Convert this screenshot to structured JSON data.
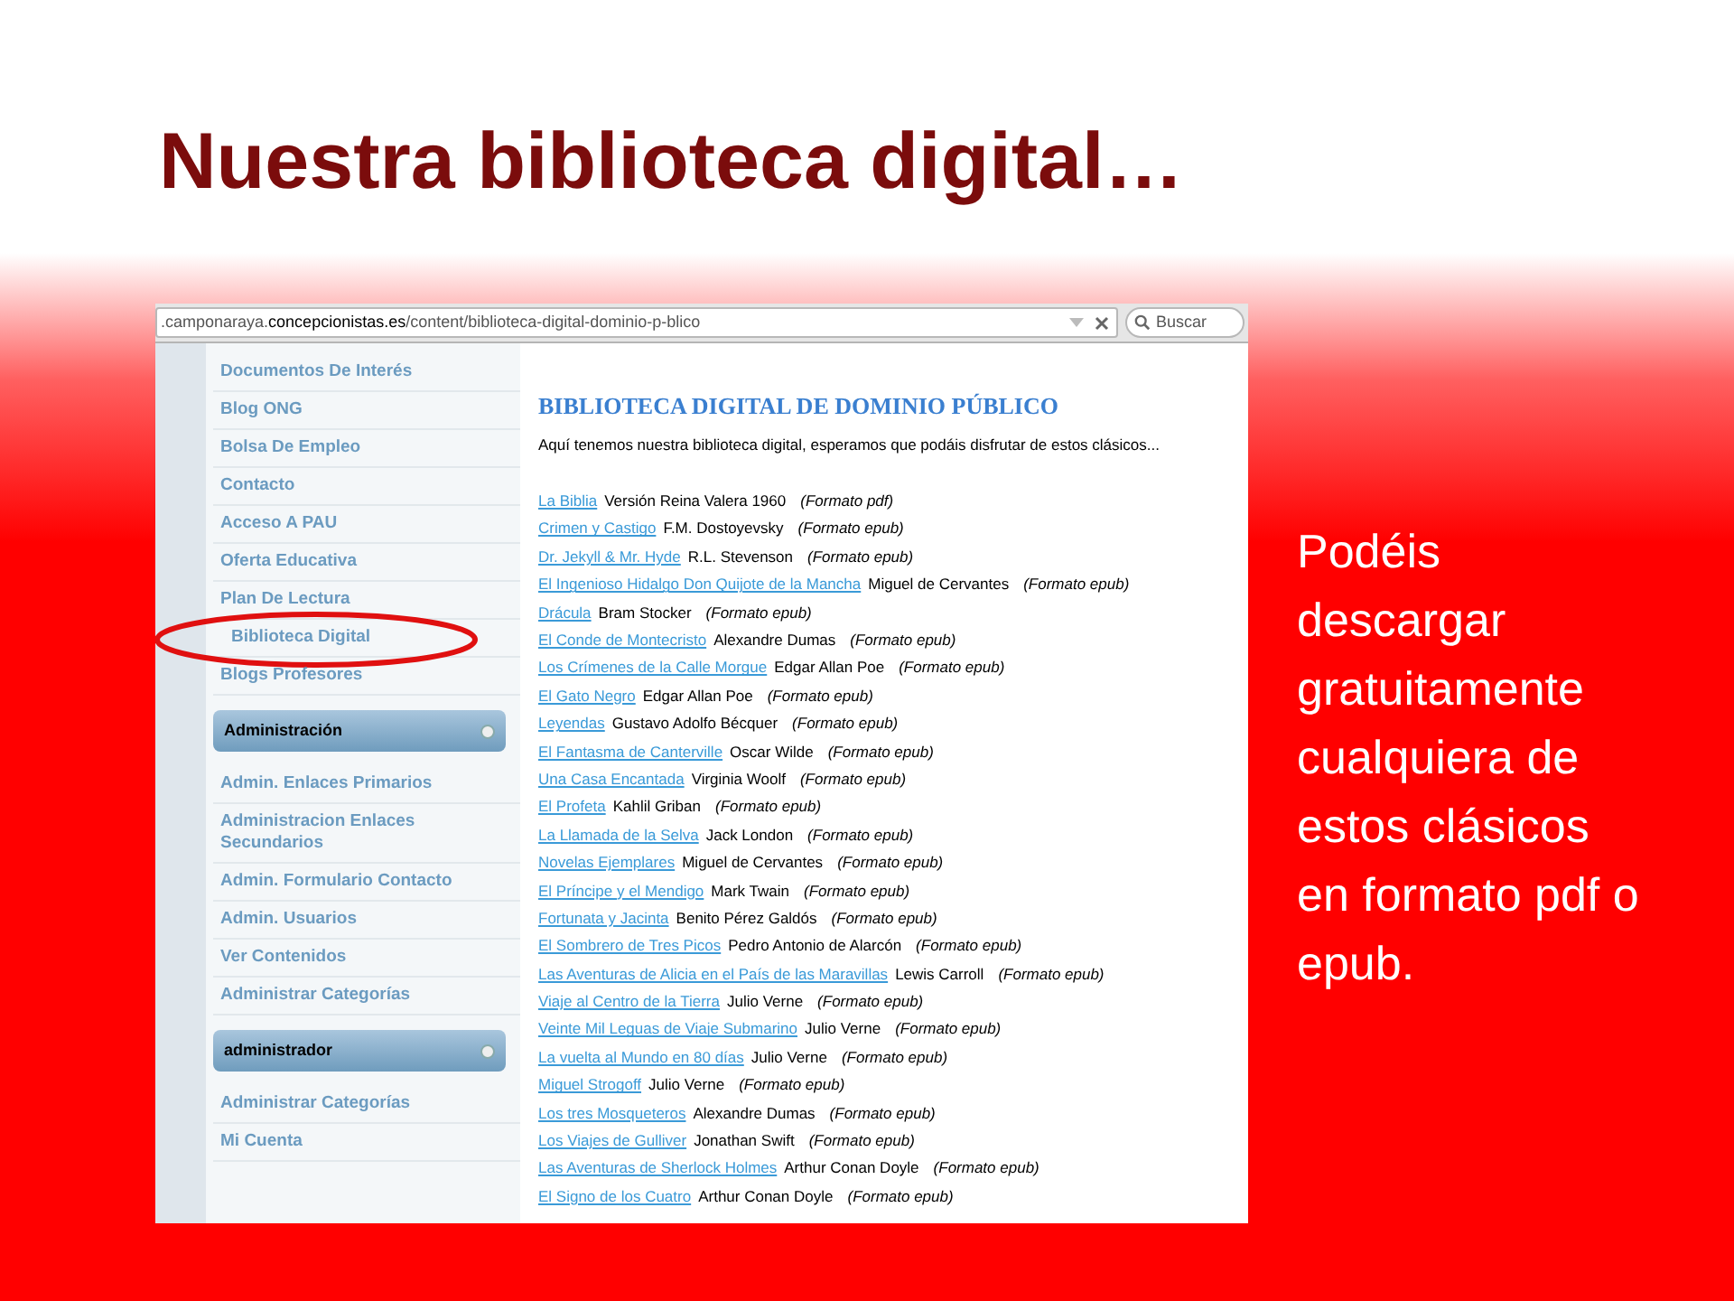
{
  "slide_title": "Nuestra biblioteca digital…",
  "browser": {
    "url_prefix": ".camponaraya.",
    "url_domain": "concepcionistas.es",
    "url_path": "/content/biblioteca-digital-dominio-p-blico",
    "search_placeholder": "Buscar"
  },
  "sidebar": {
    "items": [
      {
        "kind": "link",
        "label": "Documentos De Interés",
        "circled": false
      },
      {
        "kind": "link",
        "label": "Blog ONG",
        "circled": false
      },
      {
        "kind": "link",
        "label": "Bolsa De Empleo",
        "circled": false
      },
      {
        "kind": "link",
        "label": "Contacto",
        "circled": false
      },
      {
        "kind": "link",
        "label": "Acceso A PAU",
        "circled": false
      },
      {
        "kind": "link",
        "label": "Oferta Educativa",
        "circled": false
      },
      {
        "kind": "link",
        "label": "Plan De Lectura",
        "circled": false
      },
      {
        "kind": "link",
        "label": "Biblioteca Digital",
        "circled": true
      },
      {
        "kind": "link",
        "label": "Blogs Profesores",
        "circled": false
      },
      {
        "kind": "header",
        "label": "Administración"
      },
      {
        "kind": "link",
        "label": "Admin. Enlaces Primarios",
        "circled": false
      },
      {
        "kind": "link",
        "label": "Administracion Enlaces Secundarios",
        "circled": false
      },
      {
        "kind": "link",
        "label": "Admin. Formulario Contacto",
        "circled": false
      },
      {
        "kind": "link",
        "label": "Admin. Usuarios",
        "circled": false
      },
      {
        "kind": "link",
        "label": "Ver Contenidos",
        "circled": false
      },
      {
        "kind": "link",
        "label": "Administrar Categorías",
        "circled": false
      },
      {
        "kind": "header",
        "label": "administrador"
      },
      {
        "kind": "link",
        "label": "Administrar Categorías",
        "circled": false
      },
      {
        "kind": "link",
        "label": "Mi Cuenta",
        "circled": false
      }
    ]
  },
  "content": {
    "heading": "BIBLIOTECA DIGITAL DE DOMINIO PÚBLICO",
    "intro": "Aquí tenemos nuestra biblioteca digital, esperamos que podáis disfrutar de estos clásicos...",
    "books": [
      {
        "title": "La Biblia",
        "author": "Versión Reina Valera 1960",
        "format": "(Formato pdf)"
      },
      {
        "title": "Crimen y Castigo",
        "author": "F.M. Dostoyevsky",
        "format": "(Formato epub)"
      },
      {
        "title": "Dr. Jekyll & Mr. Hyde",
        "author": "R.L. Stevenson",
        "format": "(Formato epub)"
      },
      {
        "title": "El Ingenioso Hidalgo Don Quijote de la Mancha",
        "author": "Miguel de Cervantes",
        "format": "(Formato epub)"
      },
      {
        "title": "Drácula",
        "author": "Bram Stocker",
        "format": "(Formato epub)"
      },
      {
        "title": "El Conde de Montecristo",
        "author": "Alexandre Dumas",
        "format": "(Formato epub)"
      },
      {
        "title": "Los Crímenes de la Calle Morgue",
        "author": "Edgar Allan Poe",
        "format": "(Formato epub)"
      },
      {
        "title": "El Gato Negro",
        "author": "Edgar Allan Poe",
        "format": "(Formato epub)"
      },
      {
        "title": "Leyendas",
        "author": "Gustavo Adolfo Bécquer",
        "format": "(Formato epub)"
      },
      {
        "title": "El Fantasma de Canterville",
        "author": "Oscar Wilde",
        "format": "(Formato epub)"
      },
      {
        "title": "Una Casa Encantada",
        "author": "Virginia Woolf",
        "format": "(Formato epub)"
      },
      {
        "title": "El Profeta",
        "author": "Kahlil Griban",
        "format": "(Formato epub)"
      },
      {
        "title": "La Llamada de la Selva",
        "author": "Jack London",
        "format": "(Formato epub)"
      },
      {
        "title": "Novelas Ejemplares",
        "author": "Miguel de Cervantes",
        "format": "(Formato epub)"
      },
      {
        "title": "El Príncipe y el Mendigo",
        "author": "Mark Twain",
        "format": "(Formato epub)"
      },
      {
        "title": "Fortunata y Jacinta",
        "author": "Benito Pérez Galdós",
        "format": "(Formato epub)"
      },
      {
        "title": "El Sombrero de Tres Picos",
        "author": "Pedro Antonio de Alarcón",
        "format": "(Formato epub)"
      },
      {
        "title": "Las Aventuras de Alicia en el País de las Maravillas",
        "author": "Lewis Carroll",
        "format": "(Formato epub)"
      },
      {
        "title": "Viaje al Centro de la Tierra",
        "author": "Julio Verne",
        "format": "(Formato epub)"
      },
      {
        "title": "Veinte Mil Leguas de Viaje Submarino",
        "author": "Julio Verne",
        "format": "(Formato epub)"
      },
      {
        "title": "La vuelta al Mundo en 80 días",
        "author": "Julio Verne",
        "format": "(Formato epub)"
      },
      {
        "title": "Miguel Strogoff",
        "author": "Julio Verne",
        "format": "(Formato epub)"
      },
      {
        "title": "Los tres Mosqueteros",
        "author": "Alexandre Dumas",
        "format": "(Formato epub)"
      },
      {
        "title": "Los Viajes de Gulliver",
        "author": "Jonathan Swift",
        "format": "(Formato epub)"
      },
      {
        "title": "Las Aventuras de Sherlock Holmes",
        "author": "Arthur Conan Doyle",
        "format": "(Formato epub)"
      },
      {
        "title": "El Signo de los Cuatro",
        "author": "Arthur Conan Doyle",
        "format": "(Formato epub)"
      }
    ]
  },
  "side_note": "Podéis descargar gratuitamente cualquiera de estos clásicos en formato pdf o epub."
}
